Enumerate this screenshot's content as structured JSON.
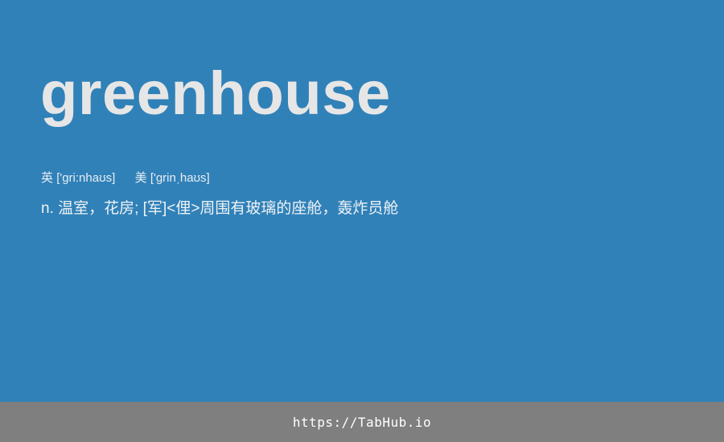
{
  "entry": {
    "word": "greenhouse",
    "phonetic_uk_label": "英",
    "phonetic_uk": "['gri:nhaʊs]",
    "phonetic_us_label": "美",
    "phonetic_us": "['grinˌhaʊs]",
    "definition": "n. 温室，花房; [军]<俚>周围有玻璃的座舱，轰炸员舱"
  },
  "footer": {
    "link_text": "https://TabHub.io"
  },
  "colors": {
    "background": "#3081b8",
    "footer_background": "#7f7f7f",
    "word_text": "#e6e6e6"
  }
}
